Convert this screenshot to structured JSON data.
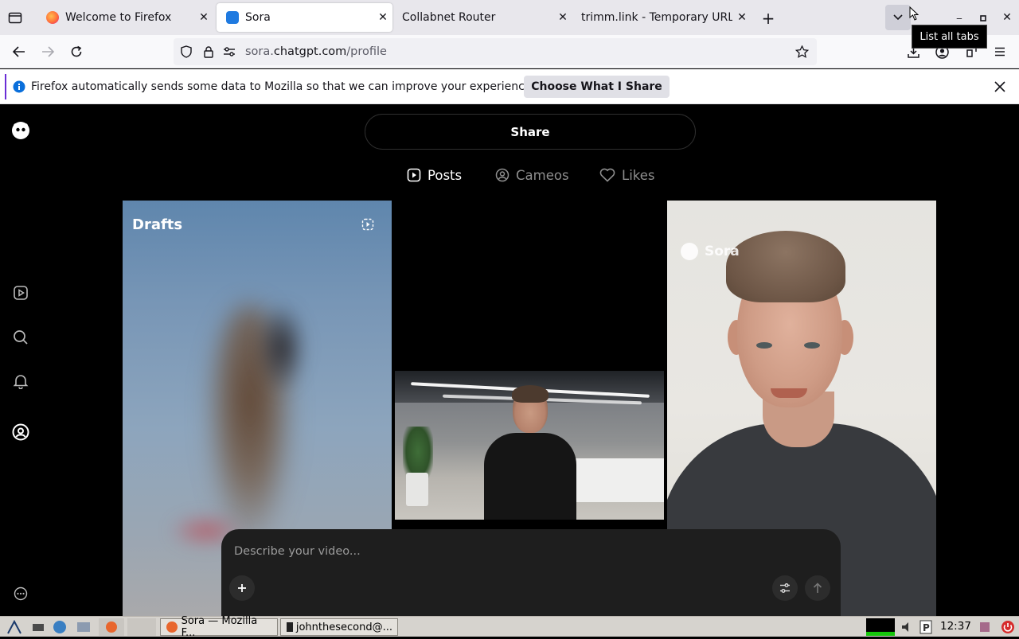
{
  "browser": {
    "tabs": [
      {
        "title": "Welcome to Firefox",
        "active": false
      },
      {
        "title": "Sora",
        "active": true
      },
      {
        "title": "Collabnet Router",
        "active": false
      },
      {
        "title": "trimm.link - Temporary URL",
        "active": false
      }
    ],
    "tooltip": "List all tabs",
    "url": {
      "prefix": "sora.",
      "domain": "chatgpt.com",
      "path": "/profile"
    },
    "notification": {
      "message": "Firefox automatically sends some data to Mozilla so that we can improve your experience.",
      "button": "Choose What I Share"
    }
  },
  "page": {
    "share_label": "Share",
    "tabs": [
      {
        "label": "Posts",
        "icon": "play-square-icon",
        "selected": true
      },
      {
        "label": "Cameos",
        "icon": "person-circle-icon",
        "selected": false
      },
      {
        "label": "Likes",
        "icon": "heart-icon",
        "selected": false
      }
    ],
    "drafts_title": "Drafts",
    "watermark": "Sora",
    "composer": {
      "placeholder": "Describe your video..."
    }
  },
  "taskbar": {
    "tasks": [
      "Sora — Mozilla F...",
      "johnthesecond@..."
    ],
    "clock": "12:37"
  },
  "colors": {
    "page_bg": "#000000",
    "notification_accent": "#6a2dd6",
    "info_icon": "#0a6fdb"
  }
}
